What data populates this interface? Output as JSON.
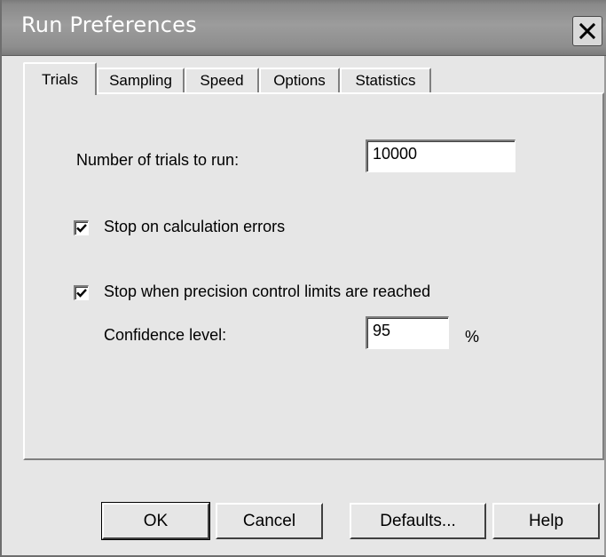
{
  "window": {
    "title": "Run Preferences"
  },
  "tabs": [
    {
      "label": "Trials"
    },
    {
      "label": "Sampling"
    },
    {
      "label": "Speed"
    },
    {
      "label": "Options"
    },
    {
      "label": "Statistics"
    }
  ],
  "trials": {
    "num_trials_label": "Number of trials to run:",
    "num_trials_value": "10000",
    "stop_calc_errors_label": "Stop on calculation errors",
    "stop_calc_errors_checked": true,
    "stop_precision_label": "Stop when precision control limits are reached",
    "stop_precision_checked": true,
    "confidence_label": "Confidence level:",
    "confidence_value": "95",
    "confidence_unit": "%"
  },
  "buttons": {
    "ok": "OK",
    "cancel": "Cancel",
    "defaults": "Defaults...",
    "help": "Help"
  },
  "icons": {
    "close": "close-icon",
    "check": "checkmark-icon"
  }
}
